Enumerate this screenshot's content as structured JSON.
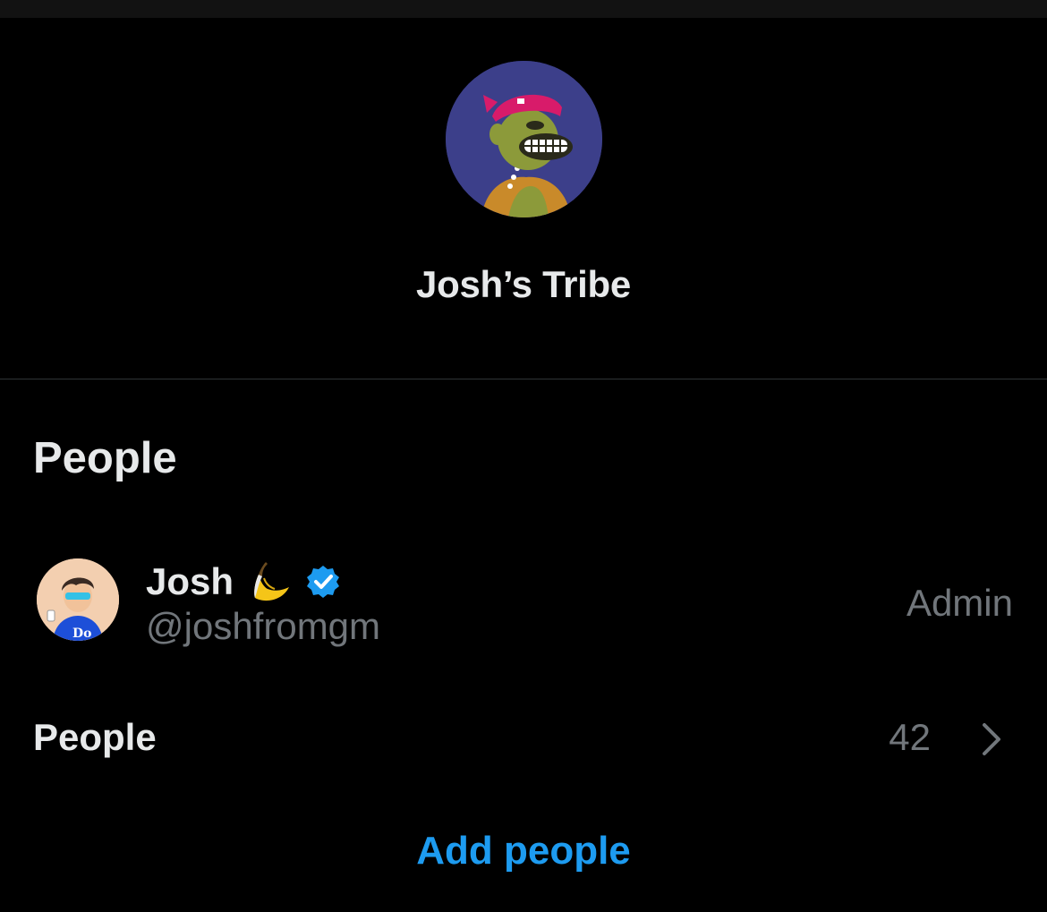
{
  "group": {
    "name": "Josh’s Tribe",
    "avatar_icon": "ape-nft-avatar"
  },
  "people_section": {
    "heading": "People",
    "members": [
      {
        "name": "Josh",
        "emoji_icon": "banana-emoji",
        "verified_icon": "verified-badge-icon",
        "handle": "@joshfromgm",
        "role": "Admin"
      }
    ],
    "people_row": {
      "label": "People",
      "count": "42",
      "chevron_icon": "chevron-right-icon"
    },
    "add_people_label": "Add people"
  },
  "colors": {
    "background": "#000000",
    "primary_text": "#e7e9ea",
    "secondary_text": "#71767b",
    "accent": "#1d9bf0",
    "divider": "#2f3336"
  }
}
